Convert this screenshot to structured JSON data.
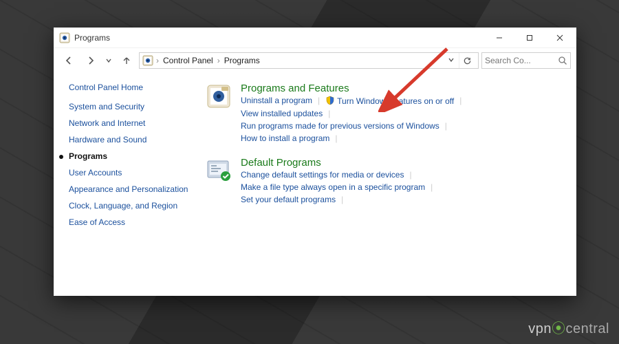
{
  "title": "Programs",
  "breadcrumb": {
    "root": "Control Panel",
    "current": "Programs"
  },
  "search": {
    "placeholder": "Search Co..."
  },
  "sidebar": {
    "home": "Control Panel Home",
    "items": [
      {
        "label": "System and Security",
        "current": false
      },
      {
        "label": "Network and Internet",
        "current": false
      },
      {
        "label": "Hardware and Sound",
        "current": false
      },
      {
        "label": "Programs",
        "current": true
      },
      {
        "label": "User Accounts",
        "current": false
      },
      {
        "label": "Appearance and Personalization",
        "current": false
      },
      {
        "label": "Clock, Language, and Region",
        "current": false
      },
      {
        "label": "Ease of Access",
        "current": false
      }
    ]
  },
  "groups": [
    {
      "title": "Programs and Features",
      "icon": "programs-features-icon",
      "links": [
        {
          "label": "Uninstall a program",
          "shield": false,
          "break": false
        },
        {
          "label": "Turn Windows features on or off",
          "shield": true,
          "break": true
        },
        {
          "label": "View installed updates",
          "shield": false,
          "break": true
        },
        {
          "label": "Run programs made for previous versions of Windows",
          "shield": false,
          "break": true
        },
        {
          "label": "How to install a program",
          "shield": false,
          "break": true
        }
      ]
    },
    {
      "title": "Default Programs",
      "icon": "default-programs-icon",
      "links": [
        {
          "label": "Change default settings for media or devices",
          "shield": false,
          "break": true
        },
        {
          "label": "Make a file type always open in a specific program",
          "shield": false,
          "break": true
        },
        {
          "label": "Set your default programs",
          "shield": false,
          "break": true
        }
      ]
    }
  ],
  "watermark": {
    "a": "vpn",
    "b": "central"
  }
}
